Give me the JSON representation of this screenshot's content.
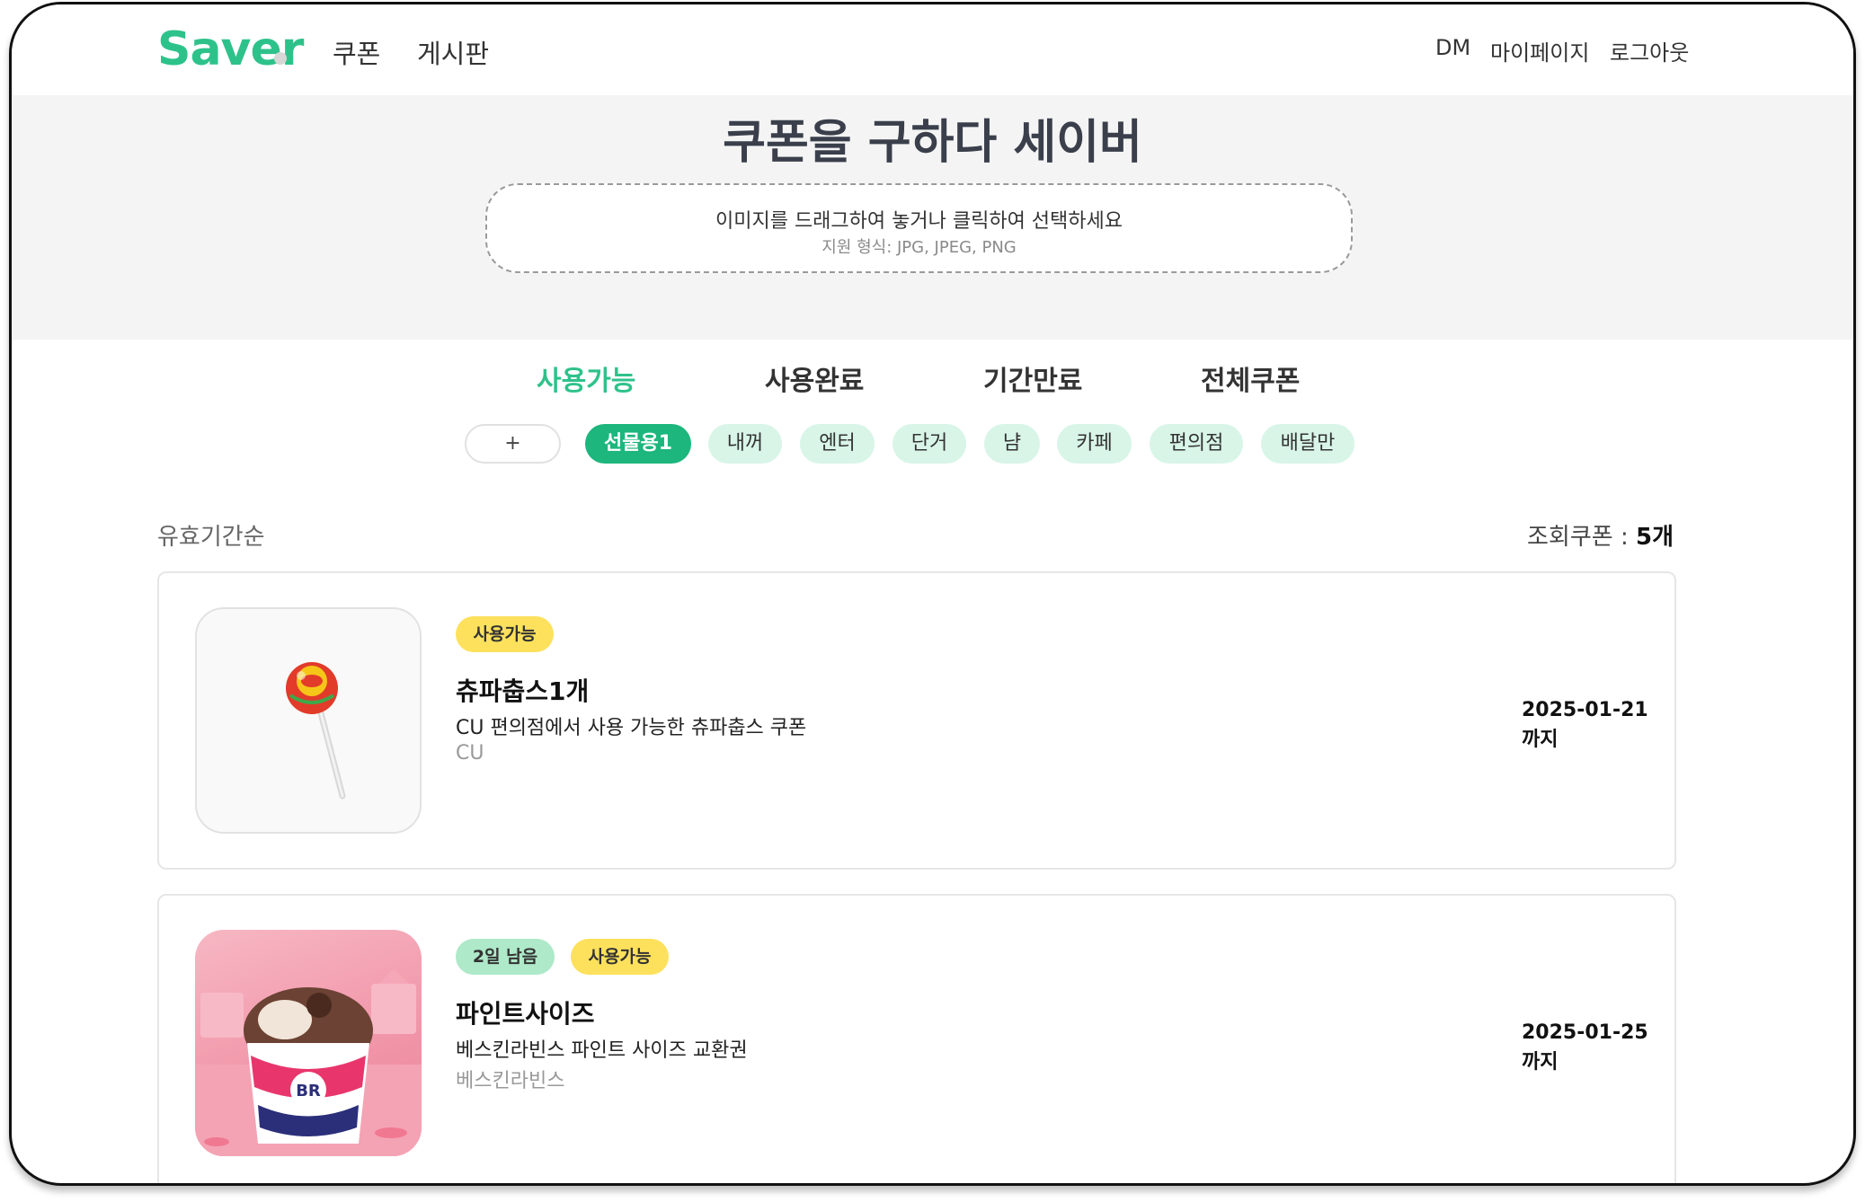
{
  "header": {
    "logo": "Saver",
    "nav": [
      "쿠폰",
      "게시판"
    ],
    "right_links": [
      "DM",
      "마이페이지",
      "로그아웃"
    ]
  },
  "hero": {
    "title": "쿠폰을 구하다 세이버",
    "dropzone_main": "이미지를 드래그하여 놓거나 클릭하여 선택하세요",
    "dropzone_sub": "지원 형식: JPG, JPEG, PNG"
  },
  "tabs": [
    {
      "label": "사용가능",
      "active": true
    },
    {
      "label": "사용완료",
      "active": false
    },
    {
      "label": "기간만료",
      "active": false
    },
    {
      "label": "전체쿠폰",
      "active": false
    }
  ],
  "categories": {
    "add_label": "+",
    "items": [
      "선물용1",
      "내꺼",
      "엔터",
      "단거",
      "냠",
      "카페",
      "편의점",
      "배달만"
    ],
    "selected": "선물용1"
  },
  "list": {
    "sort_label": "유효기간순",
    "count_label": "조회쿠폰 : ",
    "count_value": "5개"
  },
  "coupons": [
    {
      "badges": [
        "사용가능"
      ],
      "title": "츄파춥스1개",
      "description": "CU 편의점에서 사용 가능한 츄파춥스 쿠폰",
      "brand": "CU",
      "date": "2025-01-21",
      "until": "까지",
      "image": "lollipop-image"
    },
    {
      "badges": [
        "2일 남음",
        "사용가능"
      ],
      "title": "파인트사이즈",
      "description": "베스킨라빈스 파인트 사이즈 교환권",
      "brand": "베스킨라빈스",
      "date": "2025-01-25",
      "until": "까지",
      "image": "ice-cream-image"
    }
  ],
  "colors": {
    "accent": "#2ec28b",
    "chip_active": "#1db67d",
    "chip_bg": "#d8f5e8",
    "badge_yellow": "#fde15c",
    "badge_green": "#aee9c9"
  }
}
